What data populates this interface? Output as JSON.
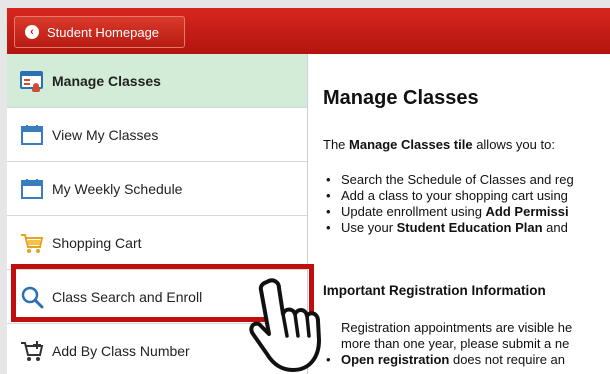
{
  "header": {
    "home_button": "Student Homepage"
  },
  "sidebar": {
    "items": [
      {
        "label": "Manage Classes",
        "icon": "manage-classes-icon",
        "active": true
      },
      {
        "label": "View My Classes",
        "icon": "calendar-icon"
      },
      {
        "label": "My Weekly Schedule",
        "icon": "calendar-icon"
      },
      {
        "label": "Shopping Cart",
        "icon": "shopping-cart-icon"
      },
      {
        "label": "Class Search and Enroll",
        "icon": "search-icon"
      },
      {
        "label": "Add By Class Number",
        "icon": "cart-add-icon"
      }
    ]
  },
  "main": {
    "title": "Manage Classes",
    "intro_prefix": "The ",
    "intro_bold": "Manage Classes tile",
    "intro_suffix": " allows you to:",
    "bullets": [
      {
        "text": "Search the Schedule of Classes and reg"
      },
      {
        "text": "Add a class to your shopping cart using"
      },
      {
        "prefix": "Update enrollment using ",
        "bold": "Add Permissi"
      },
      {
        "prefix": "Use your ",
        "bold": "Student Education Plan",
        "suffix": " and"
      }
    ],
    "section_title": "Important Registration Information",
    "para_line1": "Registration appointments are visible he",
    "para_line2": "more than one year, please submit a ne",
    "last_bullet_bold": "Open registration",
    "last_bullet_text": " does not require an"
  },
  "colors": {
    "header_red": "#c41e15",
    "active_bg": "#d3ecd8",
    "highlight_red": "#c00d0d"
  }
}
